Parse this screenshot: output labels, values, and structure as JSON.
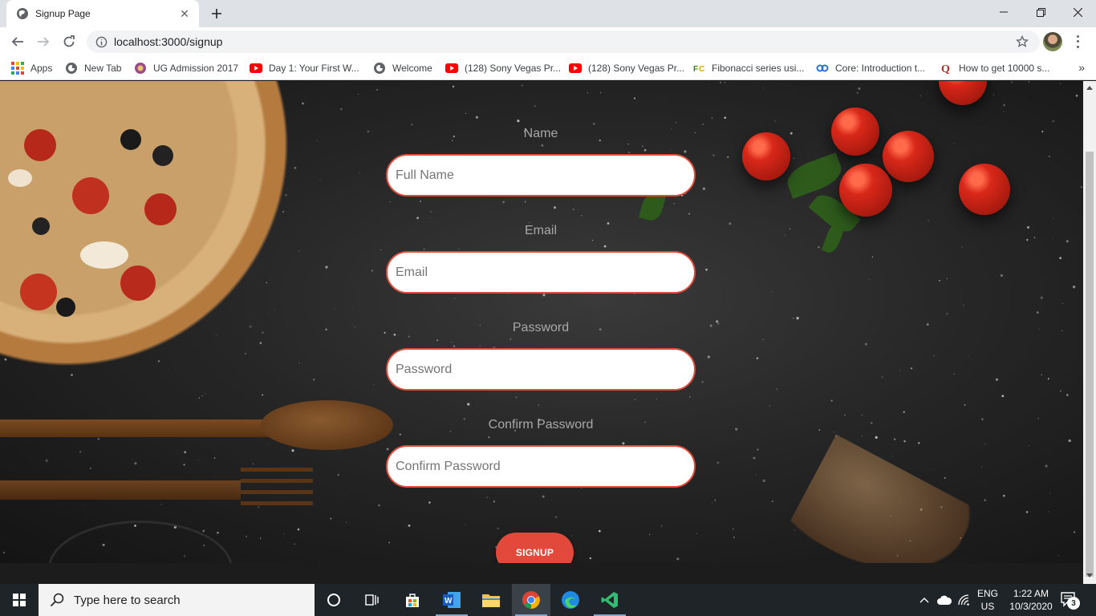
{
  "browser": {
    "tab_title": "Signup Page",
    "url": "localhost:3000/signup",
    "bookmarks": [
      {
        "label": "Apps",
        "icon": "apps-grid-icon"
      },
      {
        "label": "New Tab",
        "icon": "globe-icon"
      },
      {
        "label": "UG Admission 2017",
        "icon": "university-icon"
      },
      {
        "label": "Day 1: Your First W...",
        "icon": "youtube-icon"
      },
      {
        "label": "Welcome",
        "icon": "globe-icon"
      },
      {
        "label": "(128) Sony Vegas Pr...",
        "icon": "youtube-icon"
      },
      {
        "label": "(128) Sony Vegas Pr...",
        "icon": "youtube-icon"
      },
      {
        "label": "Fibonacci series usi...",
        "icon": "fc-icon"
      },
      {
        "label": "Core: Introduction t...",
        "icon": "coursera-icon"
      },
      {
        "label": "How to get 10000 s...",
        "icon": "quora-icon"
      }
    ]
  },
  "form": {
    "name_label": "Name",
    "name_placeholder": "Full Name",
    "email_label": "Email",
    "email_placeholder": "Email",
    "password_label": "Password",
    "password_placeholder": "Password",
    "confirm_label": "Confirm Password",
    "confirm_placeholder": "Confirm Password",
    "submit_label": "SIGNUP"
  },
  "taskbar": {
    "search_placeholder": "Type here to search",
    "lang": "ENG",
    "region": "US",
    "time": "1:22 AM",
    "date": "10/3/2020",
    "notification_count": "3"
  },
  "colors": {
    "accent": "#e2493a",
    "input_border": "#e04b3a",
    "label": "#a8a8a8",
    "taskbar": "#1f2428"
  }
}
